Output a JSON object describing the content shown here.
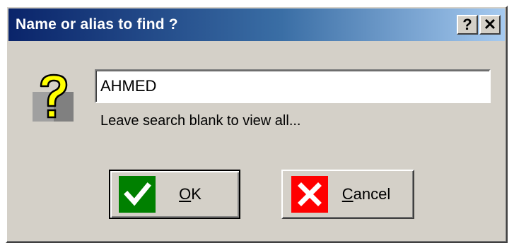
{
  "window": {
    "title": "Name or alias to find ?",
    "help_label": "?",
    "close_label": "✕"
  },
  "search": {
    "value": "AHMED",
    "hint": "Leave search blank to view all..."
  },
  "buttons": {
    "ok": {
      "mnemonic": "O",
      "rest": "K",
      "icon": "check-icon",
      "color": "#008000"
    },
    "cancel": {
      "mnemonic": "C",
      "rest": "ancel",
      "icon": "x-icon",
      "color": "#ff0000"
    }
  },
  "icons": {
    "dialog": "question-mark-icon"
  }
}
